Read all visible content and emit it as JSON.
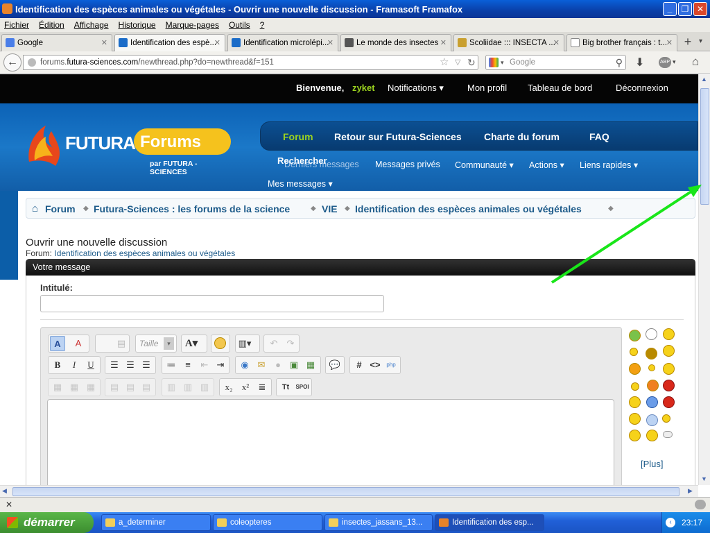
{
  "window": {
    "title": "Identification des espèces animales ou végétales - Ouvrir une nouvelle discussion - Framasoft Framafox"
  },
  "menu": [
    "Fichier",
    "Édition",
    "Affichage",
    "Historique",
    "Marque-pages",
    "Outils",
    "?"
  ],
  "tabs": [
    {
      "label": "Google",
      "icon": "google-favicon"
    },
    {
      "label": "Identification des espè...",
      "icon": "futura-favicon"
    },
    {
      "label": "Identification microlépi...",
      "icon": "futura-favicon"
    },
    {
      "label": "Le monde des insectes",
      "icon": "insect-favicon"
    },
    {
      "label": "Scoliidae ::: INSECTA ...",
      "icon": "insecta-favicon"
    },
    {
      "label": "Big brother français : t...",
      "icon": "at-favicon"
    }
  ],
  "nav": {
    "url_prefix": "forums.",
    "url_domain": "futura-sciences.com",
    "url_path": "/newthread.php?do=newthread&f=151",
    "search_placeholder": "Google"
  },
  "site": {
    "welcome": "Bienvenue,",
    "username": "zyket",
    "top_links": [
      "Notifications ▾",
      "Mon profil",
      "Tableau de bord",
      "Déconnexion"
    ],
    "logo_main": "FUTURA",
    "logo_forums": "Forums",
    "logo_sub": "par FUTURA - SCIENCES",
    "main_nav": [
      "Forum",
      "Retour sur Futura-Sciences",
      "Charte du forum",
      "FAQ"
    ],
    "search_label": "Rechercher",
    "sub_nav": [
      "Derniers messages",
      "Messages privés",
      "Communauté ▾",
      "Actions ▾",
      "Liens rapides ▾"
    ],
    "my_messages": "Mes messages ▾"
  },
  "breadcrumb": [
    "Forum",
    "Futura-Sciences : les forums de la science",
    "VIE",
    "Identification des espèces animales ou végétales"
  ],
  "page": {
    "title": "Ouvrir une nouvelle discussion",
    "forum_prefix": "Forum:",
    "forum_name": "Identification des espèces animales ou végétales",
    "block_title": "Votre message",
    "intitule_label": "Intitulé:",
    "intitule_value": "",
    "size_placeholder": "Taille",
    "smilies_more": "[Plus]"
  },
  "taskbar": {
    "start": "démarrer",
    "items": [
      "a_determiner",
      "coleopteres",
      "insectes_jassans_13...",
      "Identification des esp..."
    ],
    "time": "23:17"
  },
  "colors": {
    "accent": "#9bd21f",
    "header_blue": "#1b78c8",
    "arrow": "#19e619"
  }
}
